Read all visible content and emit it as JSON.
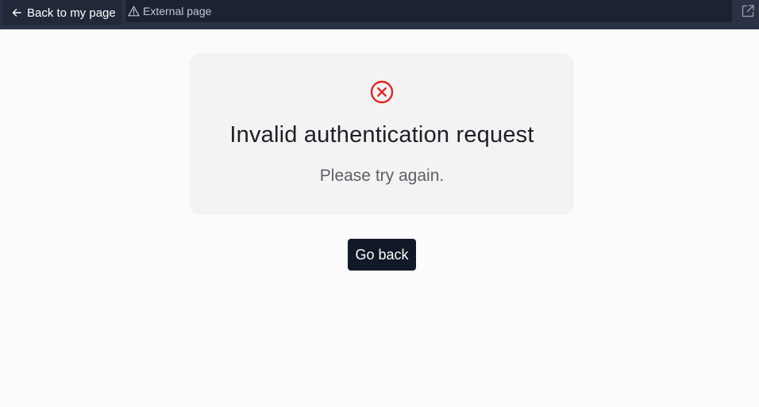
{
  "topbar": {
    "back_label": "Back to my page",
    "url_label": "External page",
    "icons": {
      "back": "arrow-left-icon",
      "warning": "warning-triangle-icon",
      "external": "external-link-icon"
    }
  },
  "card": {
    "icon": "error-circle-x-icon",
    "title": "Invalid authentication request",
    "subtitle": "Please try again."
  },
  "actions": {
    "go_back_label": "Go back"
  },
  "colors": {
    "topbar_bg": "#2b3245",
    "error_red": "#e02424",
    "button_bg": "#111827",
    "card_bg": "#f3f3f3",
    "page_bg": "#fbfbfb"
  }
}
